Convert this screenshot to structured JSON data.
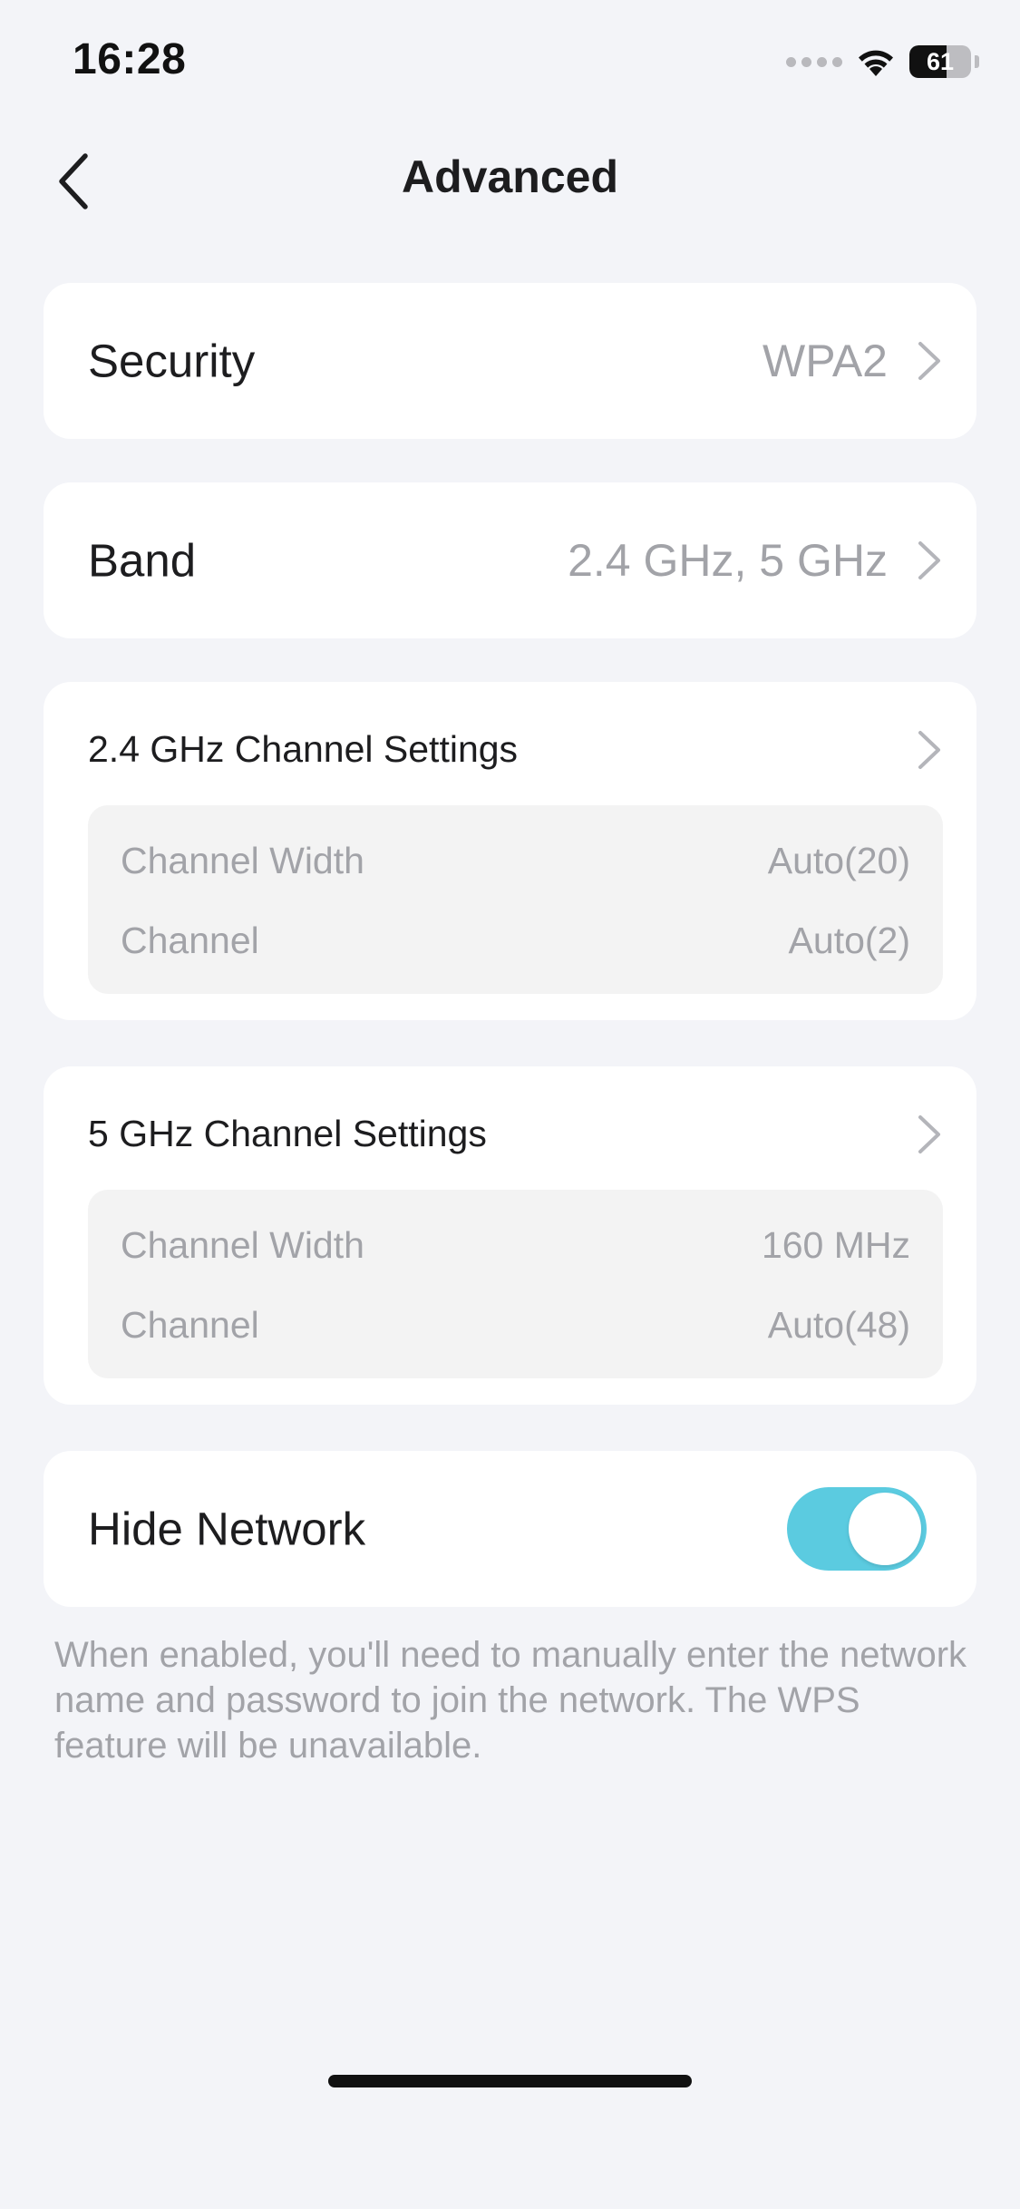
{
  "status_bar": {
    "time": "16:28",
    "battery_level": "61",
    "battery_fraction": 0.61
  },
  "header": {
    "title": "Advanced",
    "back_icon": "chevron-left-icon"
  },
  "security": {
    "label": "Security",
    "value": "WPA2"
  },
  "band": {
    "label": "Band",
    "value": "2.4 GHz, 5 GHz"
  },
  "channel_24": {
    "title": "2.4 GHz Channel Settings",
    "width_label": "Channel Width",
    "width_value": "Auto(20)",
    "channel_label": "Channel",
    "channel_value": "Auto(2)"
  },
  "channel_5": {
    "title": "5 GHz Channel Settings",
    "width_label": "Channel Width",
    "width_value": "160 MHz",
    "channel_label": "Channel",
    "channel_value": "Auto(48)"
  },
  "hide_network": {
    "label": "Hide Network",
    "enabled": true,
    "description": "When enabled, you'll need to manually enter the network name and password to join the network. The WPS feature will be unavailable."
  },
  "colors": {
    "background": "#f3f4f8",
    "card": "#ffffff",
    "toggle_on": "#5bcbe0",
    "secondary_text": "#a2a3a8"
  }
}
